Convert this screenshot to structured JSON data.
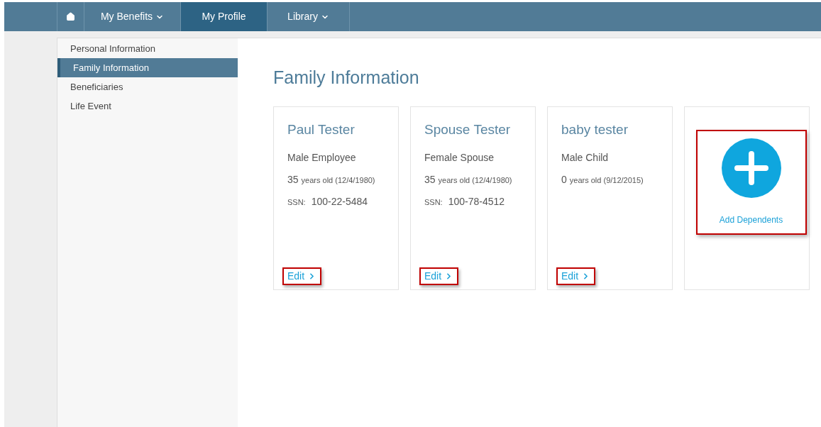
{
  "nav": [
    {
      "kind": "home",
      "selected": false
    },
    {
      "kind": "menu",
      "label": "My Benefits",
      "selected": false
    },
    {
      "kind": "link",
      "label": "My Profile",
      "selected": true
    },
    {
      "kind": "menu",
      "label": "Library",
      "selected": false
    }
  ],
  "sidebar": {
    "items": [
      {
        "label": "Personal Information",
        "selected": false
      },
      {
        "label": "Family Information",
        "selected": true
      },
      {
        "label": "Beneficiaries",
        "selected": false
      },
      {
        "label": "Life Event",
        "selected": false
      }
    ]
  },
  "page_title": "Family Information",
  "members": [
    {
      "name": "Paul Tester",
      "role": "Male Employee",
      "age": "35",
      "age_text": "years old (12/4/1980)",
      "ssn_label": "SSN:",
      "ssn": "100-22-5484",
      "edit": "Edit",
      "highlighted": true
    },
    {
      "name": "Spouse Tester",
      "role": "Female Spouse",
      "age": "35",
      "age_text": "years old (12/4/1980)",
      "ssn_label": "SSN:",
      "ssn": "100-78-4512",
      "edit": "Edit",
      "highlighted": true
    },
    {
      "name": "baby tester",
      "role": "Male Child",
      "age": "0",
      "age_text": "years old (9/12/2015)",
      "edit": "Edit",
      "highlighted": true
    }
  ],
  "add_card": {
    "label": "Add Dependents",
    "highlighted": true
  }
}
